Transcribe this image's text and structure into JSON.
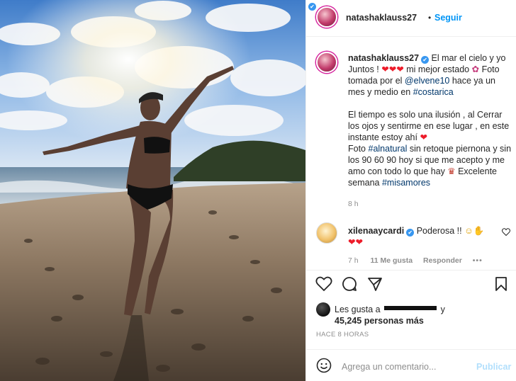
{
  "post": {
    "username": "natashaklauss27",
    "follow_label": "Seguir",
    "separator": "•"
  },
  "caption": {
    "line1_text": "El mar el cielo y yo Juntos !",
    "line1_tail": "mi mejor estado",
    "photo_by": "Foto tomada por el",
    "photo_by_user": "@elvene10",
    "photo_by_tail": "hace ya un mes y medio en",
    "location_tag": "#costarica",
    "paragraph2": "El tiempo es solo una ilusión , al Cerrar los ojos y sentirme en ese lugar , en este instante estoy ahí",
    "para3_a": "Foto",
    "para3_tag": "#alnatural",
    "para3_b": "sin retoque piernona y sin los 90 60 90 hoy si que me acepto y me amo con todo lo que hay",
    "para3_c": "Excelente semana",
    "para3_tag2": "#misamores",
    "time": "8 h"
  },
  "comment": {
    "username": "xilenaaycardi",
    "text": "Poderosa !!",
    "time": "7 h",
    "likes": "11 Me gusta",
    "reply": "Responder",
    "more": "•••"
  },
  "likes": {
    "prefix": "Les gusta a",
    "suffix": "y",
    "count": "45,245 personas más"
  },
  "post_age": "HACE 8 HORAS",
  "comment_box": {
    "placeholder": "Agrega un comentario...",
    "post_label": "Publicar"
  },
  "icons": {
    "verified": "verified-badge-icon",
    "like": "heart-outline-icon",
    "comment": "speech-bubble-icon",
    "share": "paper-plane-icon",
    "save": "bookmark-icon",
    "emoji": "smiley-icon"
  },
  "colors": {
    "link": "#00376b",
    "follow": "#0095f6",
    "verified": "#3897f0",
    "heart": "#ed1c2a",
    "muted": "#8e8e8e"
  }
}
